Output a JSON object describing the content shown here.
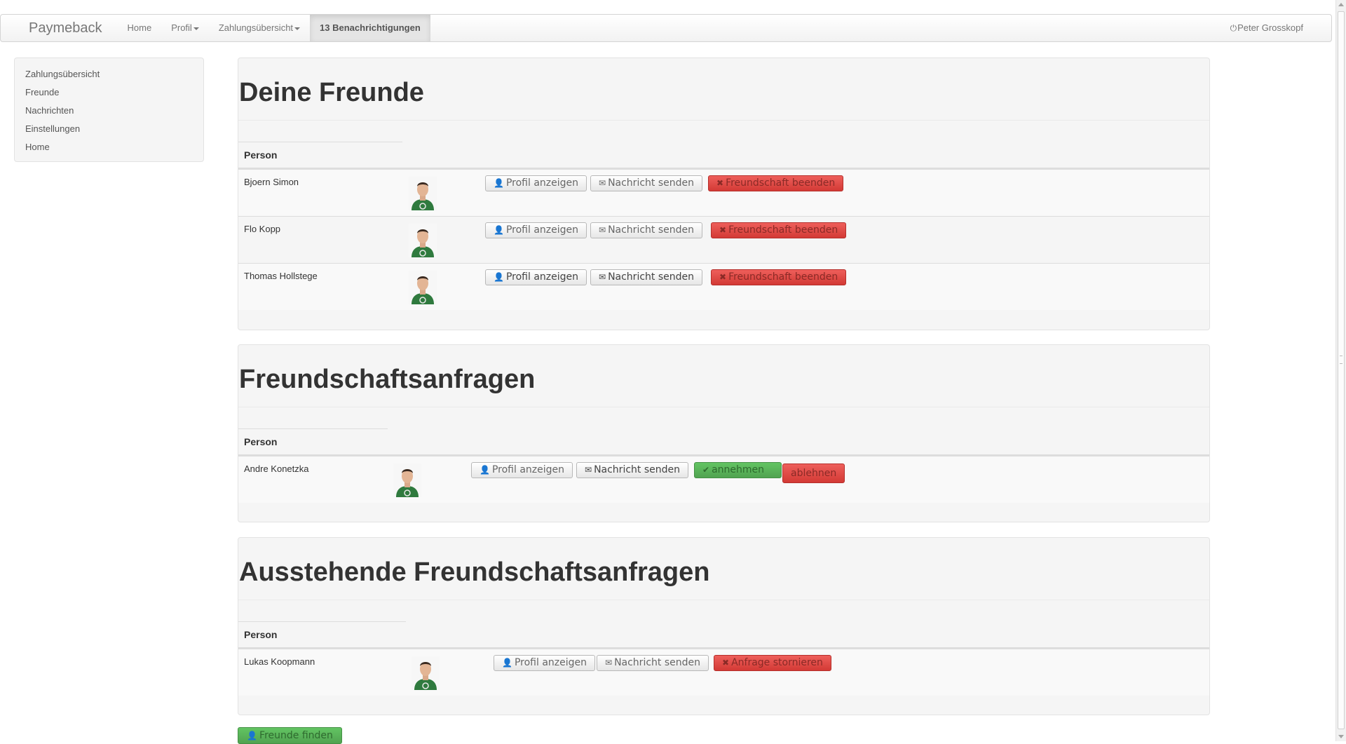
{
  "navbar": {
    "brand": "Paymeback",
    "home": "Home",
    "profil": "Profil",
    "zahlungen": "Zahlungsübersicht",
    "notifications": "13 Benachrichtigungen",
    "user": "Peter Grosskopf",
    "power_icon": "⏻"
  },
  "sidebar": {
    "items": [
      {
        "label": "Zahlungsübersicht"
      },
      {
        "label": "Freunde"
      },
      {
        "label": "Nachrichten"
      },
      {
        "label": "Einstellungen"
      },
      {
        "label": "Home"
      }
    ]
  },
  "column_header": "Person",
  "buttons": {
    "profil": "Profil anzeigen",
    "nachricht": "Nachricht senden",
    "beenden": "Freundschaft beenden",
    "annehmen": "annehmen",
    "ablehnen": "ablehnen",
    "stornieren": "Anfrage stornieren",
    "finden": "Freunde finden"
  },
  "icons": {
    "user": "user-icon",
    "envelope": "envelope-icon",
    "remove": "remove-icon",
    "check": "check-icon",
    "power": "power-icon"
  },
  "colors": {
    "danger": "#da4f49",
    "success": "#5bb75b"
  },
  "friends": {
    "title": "Deine Freunde",
    "rows": [
      {
        "name": "Bjoern Simon"
      },
      {
        "name": "Flo Kopp"
      },
      {
        "name": "Thomas Hollstege"
      }
    ]
  },
  "requests": {
    "title": "Freundschaftsanfragen",
    "rows": [
      {
        "name": "Andre Konetzka"
      }
    ]
  },
  "pending": {
    "title": "Ausstehende Freundschaftsanfragen",
    "rows": [
      {
        "name": "Lukas Koopmann"
      }
    ]
  }
}
